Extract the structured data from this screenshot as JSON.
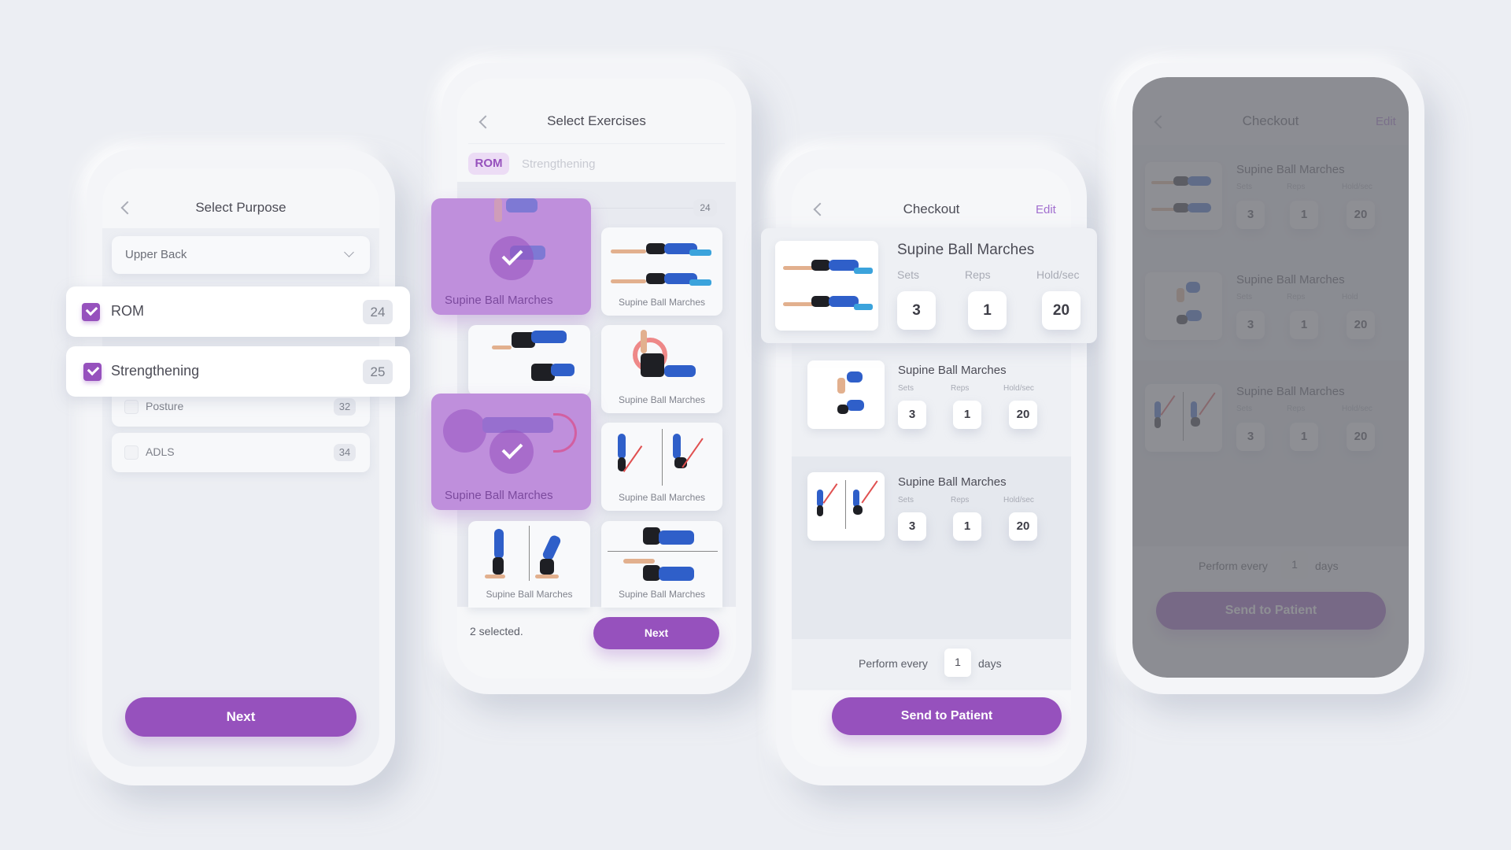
{
  "colors": {
    "accent": "#9651bd",
    "accent_light": "#bf8fdc",
    "background": "#eceef3",
    "edit_link": "#a26fcf"
  },
  "screen1": {
    "title": "Select Purpose",
    "back_icon": "chevron-left-icon",
    "dropdown": {
      "value": "Upper Back",
      "icon": "chevron-down-icon"
    },
    "purposes": [
      {
        "label": "ROM",
        "count": "24",
        "checked": true
      },
      {
        "label": "Strengthening",
        "count": "25",
        "checked": true
      },
      {
        "label": "Posture",
        "count": "32",
        "checked": false
      },
      {
        "label": "ADLS",
        "count": "34",
        "checked": false
      }
    ],
    "next_label": "Next"
  },
  "screen2": {
    "title": "Select Exercises",
    "back_icon": "chevron-left-icon",
    "tabs": [
      {
        "label": "ROM",
        "active": true
      },
      {
        "label": "Strengthening",
        "active": false
      }
    ],
    "count": "24",
    "exercises": [
      {
        "label": "Supine Ball Marches",
        "selected": true
      },
      {
        "label": "Supine Ball Marches",
        "selected": false
      },
      {
        "label": "",
        "selected": false
      },
      {
        "label": "Supine Ball Marches",
        "selected": false
      },
      {
        "label": "Supine Ball Marches",
        "selected": true
      },
      {
        "label": "Supine Ball Marches",
        "selected": false
      },
      {
        "label": "Supine Ball Marches",
        "selected": false
      },
      {
        "label": "Supine Ball Marches",
        "selected": false
      }
    ],
    "selected_text": "2 selected.",
    "next_label": "Next"
  },
  "screen3": {
    "title": "Checkout",
    "edit_label": "Edit",
    "back_icon": "chevron-left-icon",
    "items": [
      {
        "name": "Supine Ball Marches",
        "sets_label": "Sets",
        "reps_label": "Reps",
        "hold_label": "Hold/sec",
        "sets": "3",
        "reps": "1",
        "hold": "20"
      },
      {
        "name": "Supine Ball Marches",
        "sets_label": "Sets",
        "reps_label": "Reps",
        "hold_label": "Hold/sec",
        "sets": "3",
        "reps": "1",
        "hold": "20"
      },
      {
        "name": "Supine Ball Marches",
        "sets_label": "Sets",
        "reps_label": "Reps",
        "hold_label": "Hold/sec",
        "sets": "3",
        "reps": "1",
        "hold": "20"
      }
    ],
    "perform_every_label": "Perform every",
    "perform_every_value": "1",
    "days_label": "days",
    "send_label": "Send to Patient"
  },
  "screen4": {
    "title": "Checkout",
    "edit_label": "Edit",
    "back_icon": "chevron-left-icon",
    "items": [
      {
        "name": "Supine Ball Marches",
        "sets_label": "Sets",
        "reps_label": "Reps",
        "hold_label": "Hold/sec",
        "sets": "3",
        "reps": "1",
        "hold": "20"
      },
      {
        "name": "Supine Ball Marches",
        "sets_label": "Sets",
        "reps_label": "Reps",
        "hold_label": "Hold",
        "sets": "3",
        "reps": "1",
        "hold": "20"
      },
      {
        "name": "Supine Ball Marches",
        "sets_label": "Sets",
        "reps_label": "Reps",
        "hold_label": "Hold/sec",
        "sets": "3",
        "reps": "1",
        "hold": "20"
      }
    ],
    "perform_every_label": "Perform every",
    "perform_every_value": "1",
    "days_label": "days",
    "send_label": "Send to Patient"
  }
}
